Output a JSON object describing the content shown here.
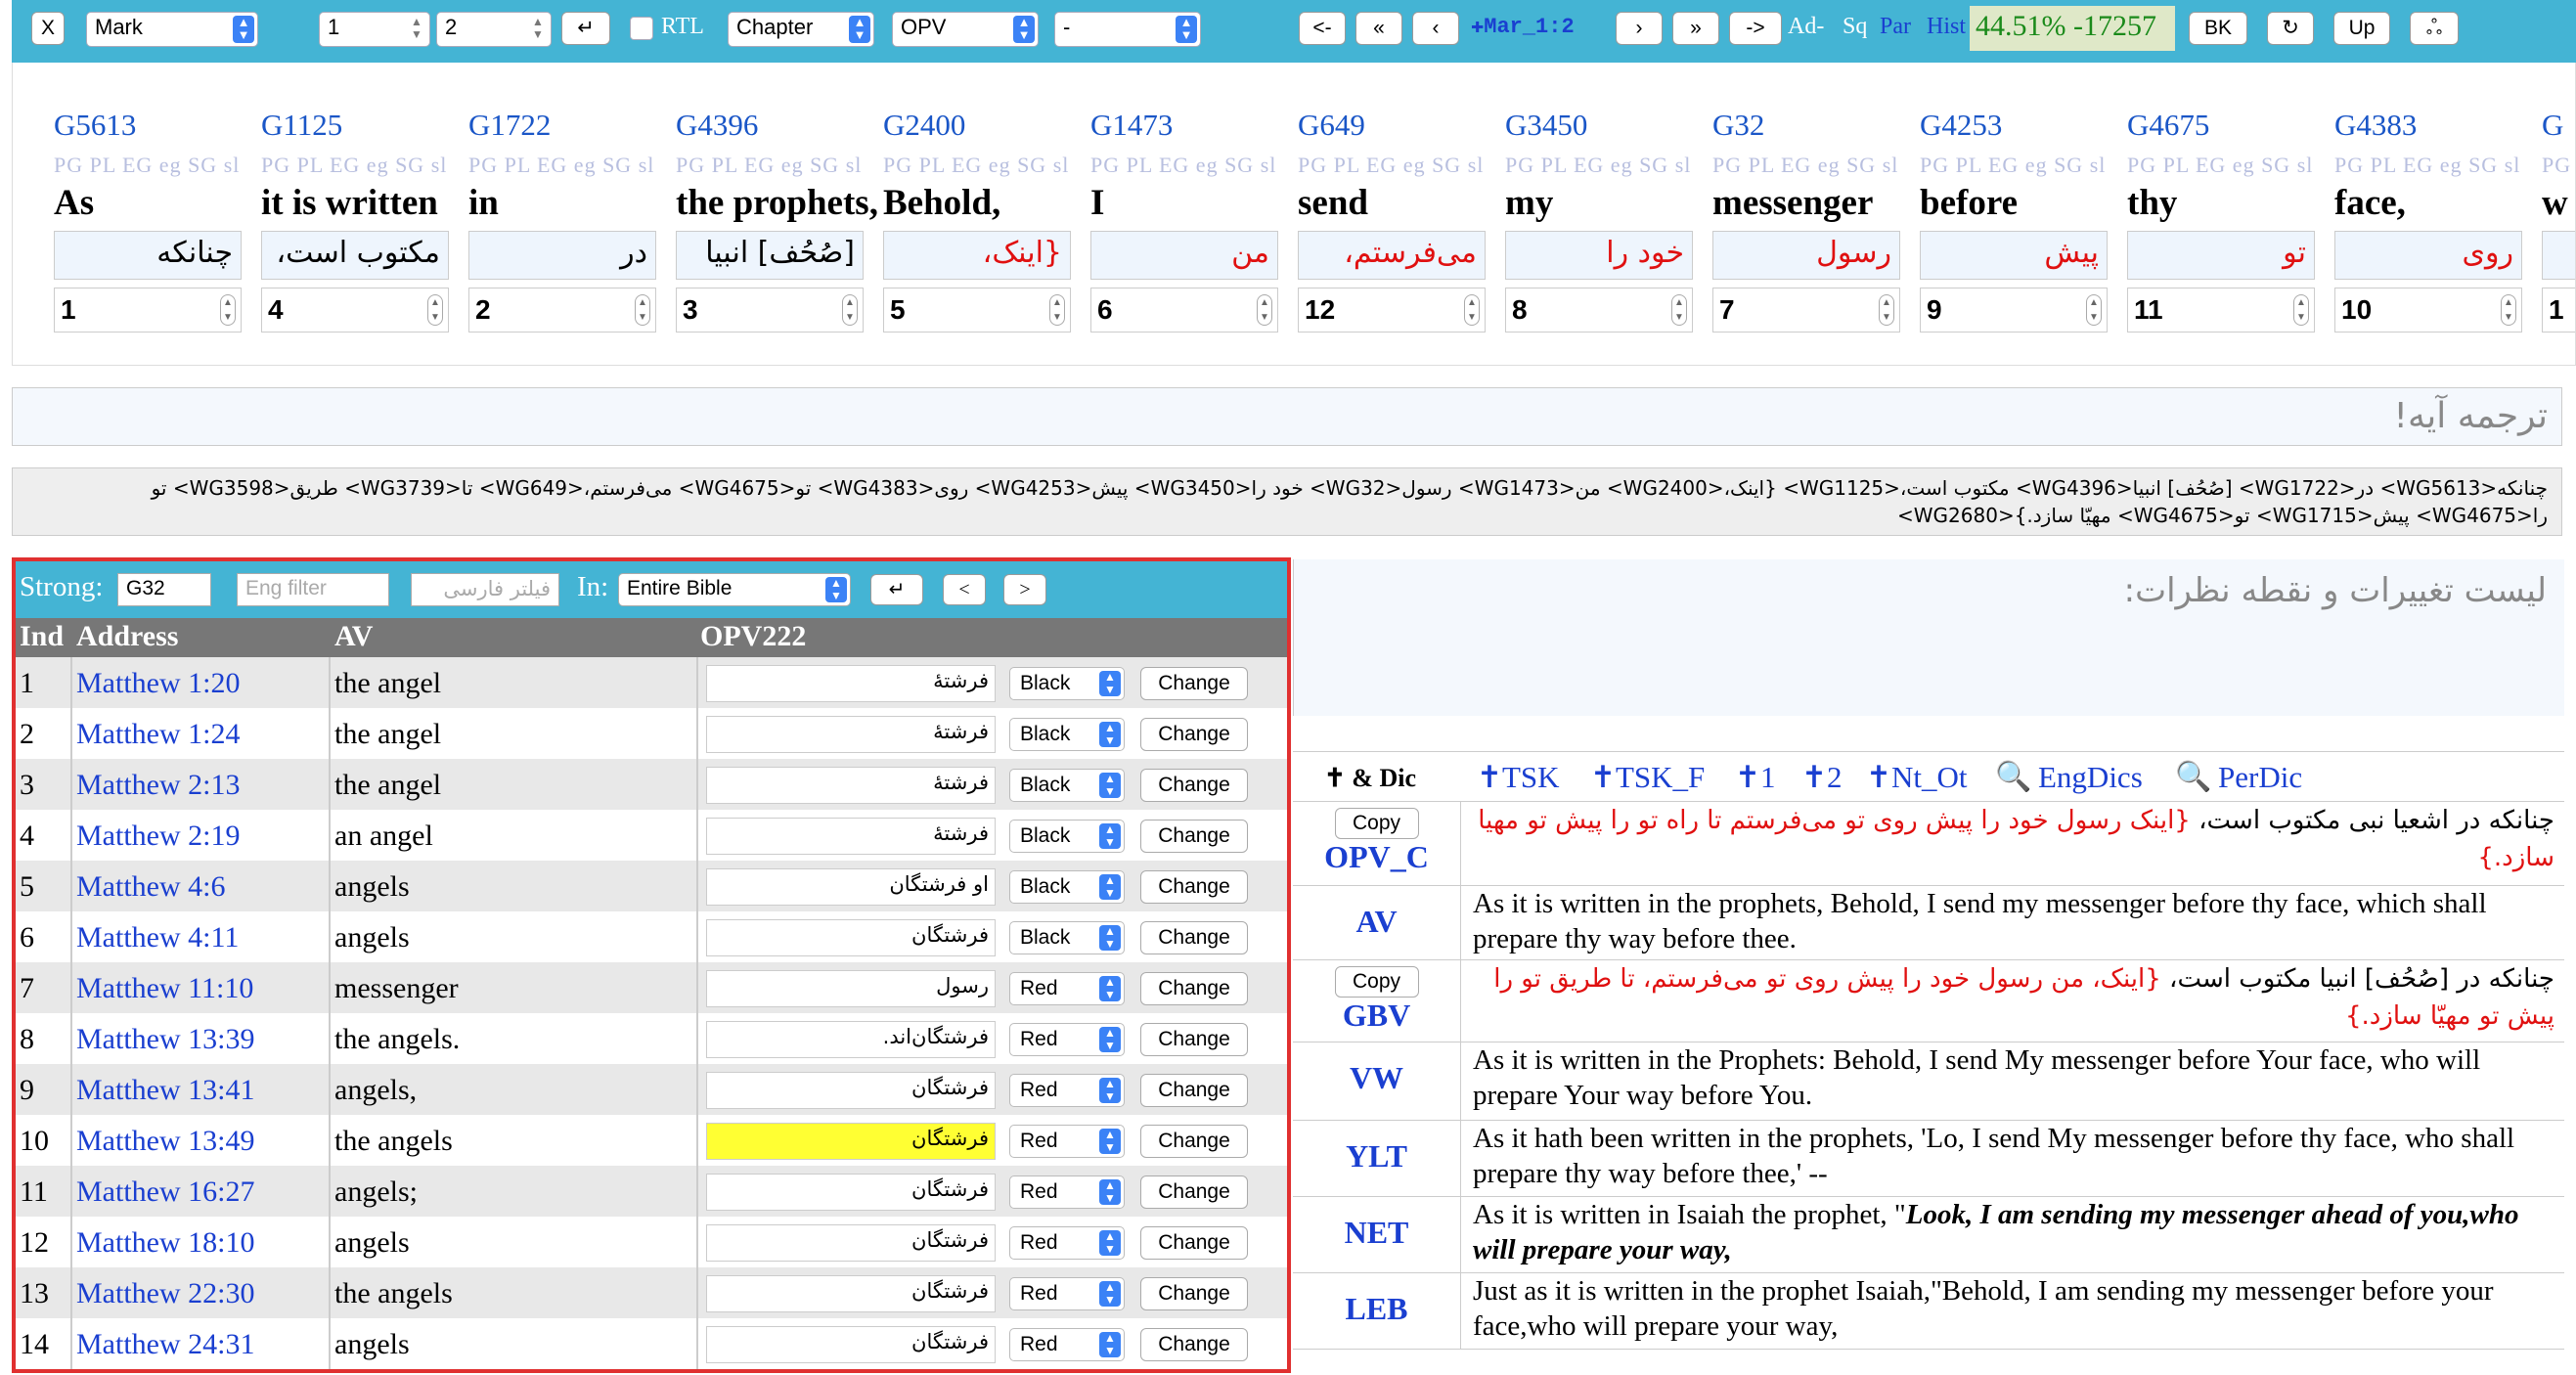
{
  "toolbar": {
    "close_label": "X",
    "book": "Mark",
    "chapter_num": "1",
    "verse_num": "2",
    "enter_label": "↵",
    "rtl_label": "RTL",
    "scope": "Chapter",
    "version": "OPV",
    "extra": "-",
    "nav_prev_label": "<-",
    "nav_first_label": "«",
    "nav_back_label": "‹",
    "reference": "✚Mar_1:2",
    "nav_fwd_label": "›",
    "nav_last_label": "»",
    "nav_next_label": "->",
    "ad_label": "Ad-",
    "sq_label": "Sq",
    "par_label": "Par",
    "hist_label": "Hist",
    "progress_text": "44.51% -17257",
    "bk_label": "BK",
    "refresh_label": "↻",
    "up_label": "Up",
    "extra_btn_label": "ஃ"
  },
  "words": [
    {
      "strong": "G5613",
      "flags": "PG PL EG eg SG sl",
      "en": "As",
      "fa": "چنانکه",
      "num": "1",
      "red": false
    },
    {
      "strong": "G1125",
      "flags": "PG PL EG eg SG sl",
      "en": "it is written",
      "fa": "مکتوب است،",
      "num": "4",
      "red": false
    },
    {
      "strong": "G1722",
      "flags": "PG PL EG eg SG sl",
      "en": "in",
      "fa": "در",
      "num": "2",
      "red": false
    },
    {
      "strong": "G4396",
      "flags": "PG PL EG eg SG sl",
      "en": "the prophets,",
      "fa": "[صُحُف] انبیا",
      "num": "3",
      "red": false
    },
    {
      "strong": "G2400",
      "flags": "PG PL EG eg SG sl",
      "en": "Behold,",
      "fa": "{اینک،",
      "num": "5",
      "red": true
    },
    {
      "strong": "G1473",
      "flags": "PG PL EG eg SG sl",
      "en": "I",
      "fa": "من",
      "num": "6",
      "red": true
    },
    {
      "strong": "G649",
      "flags": "PG PL EG eg SG sl",
      "en": "send",
      "fa": "می‌فرستم،",
      "num": "12",
      "red": true
    },
    {
      "strong": "G3450",
      "flags": "PG PL EG eg SG sl",
      "en": "my",
      "fa": "خود را",
      "num": "8",
      "red": true
    },
    {
      "strong": "G32",
      "flags": "PG PL EG eg SG sl",
      "en": "messenger",
      "fa": "رسول",
      "num": "7",
      "red": true
    },
    {
      "strong": "G4253",
      "flags": "PG PL EG eg SG sl",
      "en": "before",
      "fa": "پیش",
      "num": "9",
      "red": true
    },
    {
      "strong": "G4675",
      "flags": "PG PL EG eg SG sl",
      "en": "thy",
      "fa": "تو",
      "num": "11",
      "red": true
    },
    {
      "strong": "G4383",
      "flags": "PG PL EG eg SG sl",
      "en": "face,",
      "fa": "روی",
      "num": "10",
      "red": true
    },
    {
      "strong": "G",
      "flags": "PG",
      "en": "w",
      "fa": "",
      "num": "1",
      "red": false
    }
  ],
  "translation_placeholder": "ترجمه آیه!",
  "tagged_text": "چنانکه<WG5613> در<WG1722> [صُحُف] انبیا<WG4396> مکتوب است،<WG1125> {اینک،<WG2400> من<WG1473> رسول<WG32> خود را<WG3450> پیش<WG4253> روی<WG4383> تو<WG4675> می‌فرستم،<WG649> تا<WG3739> طریق<WG3598> تو را<WG4675> پیش<WG1715> تو<WG4675> مهیّا سازد.}<WG2680>",
  "strong_panel": {
    "strong_label": "Strong:",
    "strong_value": "G32",
    "eng_filter_placeholder": "Eng filter",
    "fa_filter_placeholder": "فیلتر فارسی",
    "in_label": "In:",
    "scope": "Entire Bible",
    "enter_label": "↵",
    "prev_label": "<",
    "next_label": ">",
    "columns": [
      "Ind",
      "Address",
      "AV",
      "OPV222"
    ],
    "change_label": "Change",
    "rows": [
      {
        "ind": "1",
        "addr": "Matthew 1:20",
        "av": "the angel",
        "opv": "فرشتهٔ",
        "color": "Black",
        "hl": false
      },
      {
        "ind": "2",
        "addr": "Matthew 1:24",
        "av": "the angel",
        "opv": "فرشتهٔ",
        "color": "Black",
        "hl": false
      },
      {
        "ind": "3",
        "addr": "Matthew 2:13",
        "av": "the angel",
        "opv": "فرشتهٔ",
        "color": "Black",
        "hl": false
      },
      {
        "ind": "4",
        "addr": "Matthew 2:19",
        "av": "an angel",
        "opv": "فرشتهٔ",
        "color": "Black",
        "hl": false
      },
      {
        "ind": "5",
        "addr": "Matthew 4:6",
        "av": "angels",
        "opv": "او فرشتگان",
        "color": "Black",
        "hl": false
      },
      {
        "ind": "6",
        "addr": "Matthew 4:11",
        "av": "angels",
        "opv": "فرشتگان",
        "color": "Black",
        "hl": false
      },
      {
        "ind": "7",
        "addr": "Matthew 11:10",
        "av": "messenger",
        "opv": "رسول",
        "color": "Red",
        "hl": false
      },
      {
        "ind": "8",
        "addr": "Matthew 13:39",
        "av": "the angels.",
        "opv": "فرشتگان‌اند.",
        "color": "Red",
        "hl": false
      },
      {
        "ind": "9",
        "addr": "Matthew 13:41",
        "av": "angels,",
        "opv": "فرشتگان",
        "color": "Red",
        "hl": false
      },
      {
        "ind": "10",
        "addr": "Matthew 13:49",
        "av": "the angels",
        "opv": "فرشتگان",
        "color": "Red",
        "hl": true
      },
      {
        "ind": "11",
        "addr": "Matthew 16:27",
        "av": "angels;",
        "opv": "فرشتگان",
        "color": "Red",
        "hl": false
      },
      {
        "ind": "12",
        "addr": "Matthew 18:10",
        "av": "angels",
        "opv": "فرشتگان",
        "color": "Red",
        "hl": false
      },
      {
        "ind": "13",
        "addr": "Matthew 22:30",
        "av": "the angels",
        "opv": "فرشتگان",
        "color": "Red",
        "hl": false
      },
      {
        "ind": "14",
        "addr": "Matthew 24:31",
        "av": "angels",
        "opv": "فرشتگان",
        "color": "Red",
        "hl": false
      }
    ]
  },
  "notes_title": "لیست تغییرات و نقطه نظرات:",
  "dic_bar": {
    "dic_label": "✝ & Dic",
    "links": [
      "✝TSK",
      "✝TSK_F",
      "✝1",
      "✝2",
      "✝Nt_Ot"
    ],
    "eng_dics": "EngDics",
    "per_dic": "PerDic"
  },
  "versions": [
    {
      "name": "OPV_C",
      "copy": "Copy",
      "rtl": true,
      "plain": "چنانکه در اشعیا نبی مکتوب است، ",
      "red": "{اینک رسول خود را پیش روی تو می‌فرستم تا راه تو را پیش تو مهیا سازد.}",
      "tail": ""
    },
    {
      "name": "AV",
      "copy": "",
      "rtl": false,
      "plain": "As it is written in the prophets, Behold, I send my messenger before thy face, which shall prepare thy way before thee.",
      "red": "",
      "tail": ""
    },
    {
      "name": "GBV",
      "copy": "Copy",
      "rtl": true,
      "plain": "چنانکه در [صُحُف] انبیا مکتوب است، ",
      "red": "{اینک، من رسول خود را پیش روی تو می‌فرستم، تا طریق تو را پیش تو مهیّا سازد.}",
      "tail": ""
    },
    {
      "name": "VW",
      "copy": "",
      "rtl": false,
      "plain": "As it is written in the Prophets: Behold, I send My messenger before Your face, who will prepare Your way before You.",
      "red": "",
      "tail": ""
    },
    {
      "name": "YLT",
      "copy": "",
      "rtl": false,
      "plain": "As it hath been written in the prophets, 'Lo, I send My messenger before thy face, who shall prepare thy way before thee,' --",
      "red": "",
      "tail": ""
    },
    {
      "name": "NET",
      "copy": "",
      "rtl": false,
      "plain": "As it is written in Isaiah the prophet, \"",
      "red": "",
      "tail": "Look, I am sending my messenger ahead of you,who will prepare your way,"
    },
    {
      "name": "LEB",
      "copy": "",
      "rtl": false,
      "plain": "Just as it is written in the prophet Isaiah,\"Behold, I am sending my messenger before your face,who will prepare your way,",
      "red": "",
      "tail": ""
    }
  ]
}
